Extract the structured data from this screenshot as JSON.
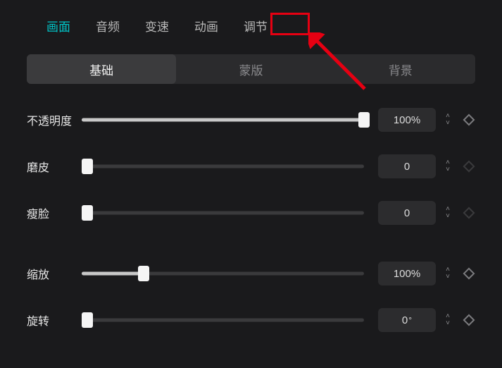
{
  "top_tabs": {
    "t0": "画面",
    "t1": "音频",
    "t2": "变速",
    "t3": "动画",
    "t4": "调节"
  },
  "sub_tabs": {
    "s0": "基础",
    "s1": "蒙版",
    "s2": "背景"
  },
  "props": {
    "opacity": {
      "label": "不透明度",
      "value": "100%",
      "pct": 100,
      "kf": true
    },
    "smooth": {
      "label": "磨皮",
      "value": "0",
      "pct": 0,
      "kf": false
    },
    "face": {
      "label": "瘦脸",
      "value": "0",
      "pct": 0,
      "kf": false
    },
    "scale": {
      "label": "缩放",
      "value": "100%",
      "pct": 22,
      "kf": true
    },
    "rotate": {
      "label": "旋转",
      "value": "0",
      "unit": "°",
      "pct": 0,
      "kf": true
    }
  }
}
